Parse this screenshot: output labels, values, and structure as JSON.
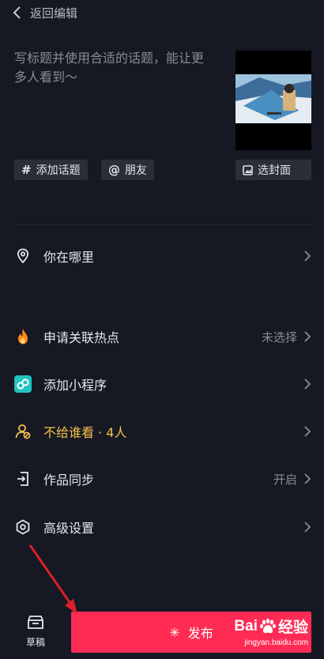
{
  "header": {
    "back_label": "返回编辑"
  },
  "caption": {
    "line1": "写标题并使用合适的话题，能让更",
    "line2": "多人看到～"
  },
  "chips": {
    "topic": "添加话题",
    "friend": "朋友",
    "cover": "选封面"
  },
  "rows": [
    {
      "icon": "location-icon",
      "label": "你在哪里",
      "value": ""
    },
    {
      "icon": "flame-icon",
      "label": "申请关联热点",
      "value": "未选择"
    },
    {
      "icon": "mini-program-icon",
      "label": "添加小程序",
      "value": ""
    },
    {
      "icon": "privacy-icon",
      "label": "不给谁看 · 4人",
      "value": ""
    },
    {
      "icon": "sync-icon",
      "label": "作品同步",
      "value": "开启"
    },
    {
      "icon": "settings-icon",
      "label": "高级设置",
      "value": ""
    }
  ],
  "bottom": {
    "draft_label": "草稿",
    "publish_label": "发布"
  },
  "watermark": {
    "brand_left": "Bai",
    "brand_right": "经验",
    "url": "jingyan.baidu.com"
  },
  "colors": {
    "background": "#161823",
    "accent": "#fe2c55",
    "privacy": "#f5c24b",
    "flame": "#ff8a1e",
    "mini_program": "#20c4c0"
  }
}
